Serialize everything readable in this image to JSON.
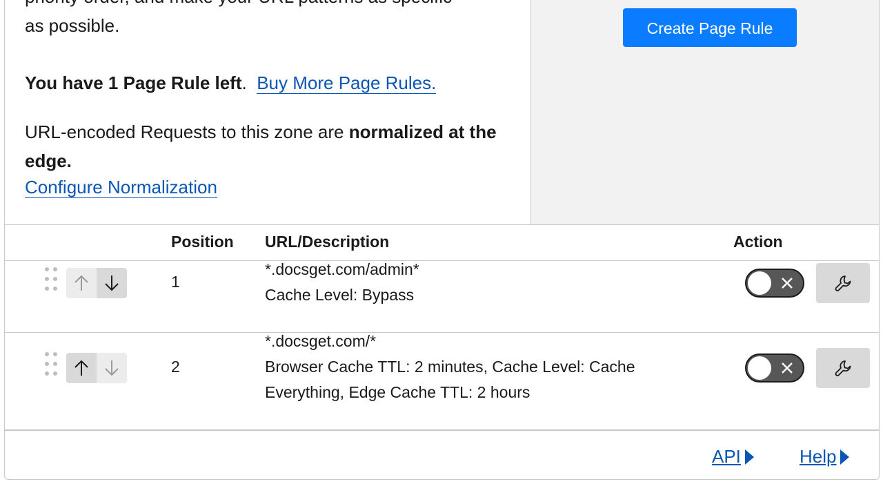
{
  "intro": {
    "cut_line": "priority order, and make your URL patterns as specific",
    "cut_line_end": "as possible.",
    "remaining_prefix": "You have 1 Page Rule left",
    "remaining_suffix": ".",
    "buy_link": "Buy More Page Rules.",
    "normalize_text": "URL-encoded Requests to this zone are ",
    "normalize_bold": "normalized at the edge.",
    "configure_link": "Configure Normalization"
  },
  "create_button": "Create Page Rule",
  "table": {
    "headers": {
      "position": "Position",
      "url": "URL/Description",
      "action": "Action"
    },
    "rows": [
      {
        "position": "1",
        "url": "*.docsget.com/admin*",
        "description": "Cache Level: Bypass",
        "enabled": false
      },
      {
        "position": "2",
        "url": "*.docsget.com/*",
        "description": "Browser Cache TTL: 2 minutes, Cache Level: Cache Everything, Edge Cache TTL: 2 hours",
        "enabled": false
      }
    ]
  },
  "footer": {
    "api": "API",
    "help": "Help"
  },
  "colors": {
    "primary_button": "#0a7cff",
    "link": "#0a56b5",
    "panel_bg": "#f2f2f2",
    "toggle_off": "#575757"
  },
  "icons": [
    "drag-handle-icon",
    "arrow-up-icon",
    "arrow-down-icon",
    "close-icon",
    "wrench-icon",
    "caret-right-icon"
  ]
}
